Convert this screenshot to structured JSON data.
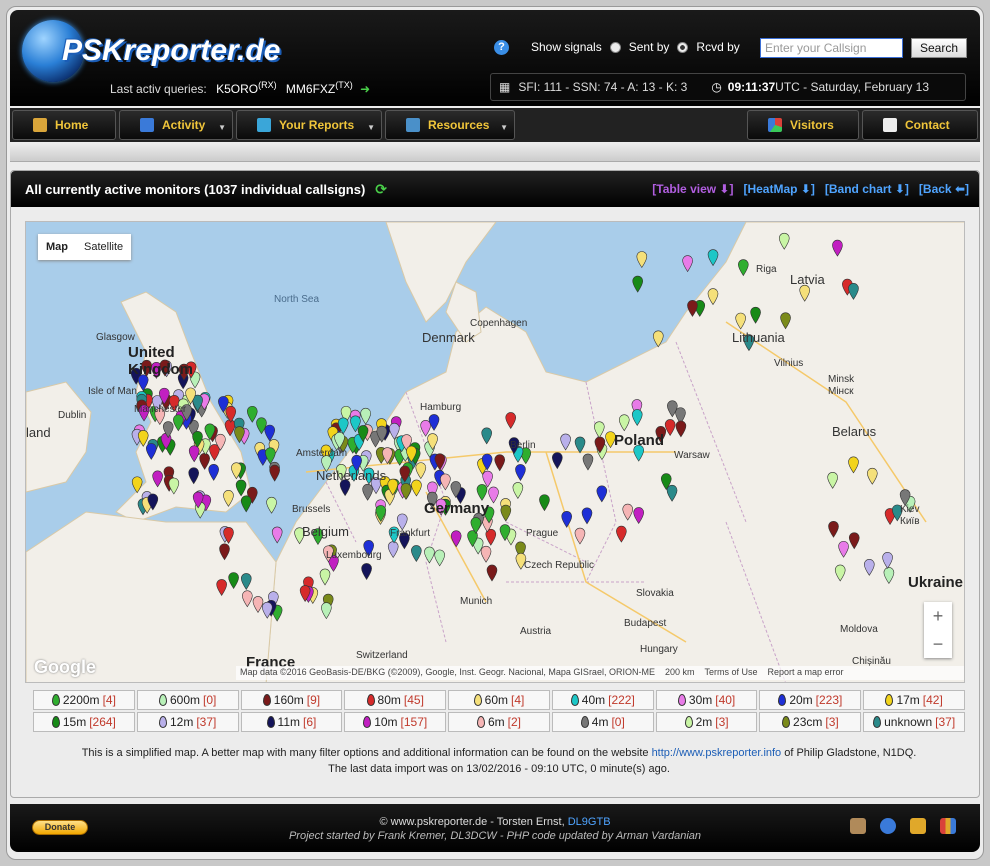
{
  "header": {
    "logo_text": "PSKreporter.de",
    "last_queries_label": "Last activ queries:",
    "last_rx": "K5ORO",
    "rx_tag": "(RX)",
    "last_tx": "MM6FXZ",
    "tx_tag": "(TX)",
    "show_signals_label": "Show signals",
    "sent_by_label": "Sent by",
    "rcvd_by_label": "Rcvd by",
    "search_placeholder": "Enter your Callsign",
    "search_button": "Search",
    "solar_data": "SFI: 111 - SSN: 74 - A: 13 - K: 3",
    "time": "09:11:37",
    "time_suffix": " UTC - Saturday, February 13"
  },
  "nav": {
    "home": "Home",
    "activity": "Activity",
    "your_reports": "Your Reports",
    "resources": "Resources",
    "visitors": "Visitors",
    "contact": "Contact"
  },
  "panel": {
    "title": "All currently active monitors (1037 individual callsigns)",
    "table_view": "[Table view ⬇]",
    "heatmap": "[HeatMap ⬇]",
    "band_chart": "[Band chart ⬇]",
    "back": "[Back ⬅]"
  },
  "map": {
    "type_map": "Map",
    "type_satellite": "Satellite",
    "google": "Google",
    "copyright": "Map data ©2016 GeoBasis-DE/BKG (©2009), Google, Inst. Geogr. Nacional, Mapa GISrael, ORION-ME",
    "scale": "200 km",
    "terms": "Terms of Use",
    "report": "Report a map error",
    "labels": {
      "north_sea": "North Sea",
      "glasgow": "Glasgow",
      "uk": "United Kingdom",
      "isle_of_man": "Isle of Man",
      "dublin": "Dublin",
      "ireland": "land",
      "manchester": "Manchester",
      "denmark": "Denmark",
      "copenhagen": "Copenhagen",
      "hamburg": "Hamburg",
      "amsterdam": "Amsterdam",
      "netherlands": "Netherlands",
      "brussels": "Brussels",
      "belgium": "Belgium",
      "luxembourg": "Luxembourg",
      "frankfurt": "Frankfurt",
      "germany": "Germany",
      "berlin": "Berlin",
      "prague": "Prague",
      "czech": "Czech Republic",
      "munich": "Munich",
      "austria": "Austria",
      "switzerland": "Switzerland",
      "france": "France",
      "poland": "Poland",
      "warsaw": "Warsaw",
      "slovakia": "Slovakia",
      "budapest": "Budapest",
      "hungary": "Hungary",
      "latvia": "Latvia",
      "riga": "Riga",
      "lithuania": "Lithuania",
      "vilnius": "Vilnius",
      "minsk": "Minsk",
      "minsk_local": "Мінск",
      "belarus": "Belarus",
      "kiev": "Kiev",
      "kiev_local": "Київ",
      "ukraine": "Ukraine",
      "moldova": "Moldova",
      "chisinau": "Chișinău",
      "zoom_in": "+",
      "zoom_out": "−"
    }
  },
  "legend": [
    [
      {
        "band": "2200m",
        "count": "[4]",
        "color": "#2fae2f"
      },
      {
        "band": "600m",
        "count": "[0]",
        "color": "#b8f0b8"
      },
      {
        "band": "160m",
        "count": "[9]",
        "color": "#7a1a1a"
      },
      {
        "band": "80m",
        "count": "[45]",
        "color": "#d62a2a"
      },
      {
        "band": "60m",
        "count": "[4]",
        "color": "#f5e07a"
      },
      {
        "band": "40m",
        "count": "[222]",
        "color": "#1cc7c7"
      },
      {
        "band": "30m",
        "count": "[40]",
        "color": "#e87be8"
      },
      {
        "band": "20m",
        "count": "[223]",
        "color": "#1e2fd6"
      },
      {
        "band": "17m",
        "count": "[42]",
        "color": "#f2d41c"
      }
    ],
    [
      {
        "band": "15m",
        "count": "[264]",
        "color": "#178a17"
      },
      {
        "band": "12m",
        "count": "[37]",
        "color": "#b9b0ea"
      },
      {
        "band": "11m",
        "count": "[6]",
        "color": "#14145a"
      },
      {
        "band": "10m",
        "count": "[157]",
        "color": "#c11fc1"
      },
      {
        "band": "6m",
        "count": "[2]",
        "color": "#f5b5b5"
      },
      {
        "band": "4m",
        "count": "[0]",
        "color": "#777777"
      },
      {
        "band": "2m",
        "count": "[3]",
        "color": "#c9f5a5"
      },
      {
        "band": "23cm",
        "count": "[3]",
        "color": "#7a8a1a"
      },
      {
        "band": "unknown",
        "count": "[37]",
        "color": "#2a8a8a"
      }
    ]
  ],
  "note": {
    "line1_pre": "This is a simplified map. A better map with many filter options and additional information can be found on the website ",
    "link": "http://www.pskreporter.info",
    "line1_post": " of Philip Gladstone, N1DQ.",
    "line2": "The last data import was on 13/02/2016 - 09:10 UTC, 0 minute(s) ago."
  },
  "footer": {
    "donate": "Donate",
    "line1": "© www.pskreporter.de - Torsten Ernst, ",
    "callsign": "DL9GTB",
    "line2": "Project started by Frank Kremer, DL3DCW - PHP code updated by Arman Vardanian"
  }
}
